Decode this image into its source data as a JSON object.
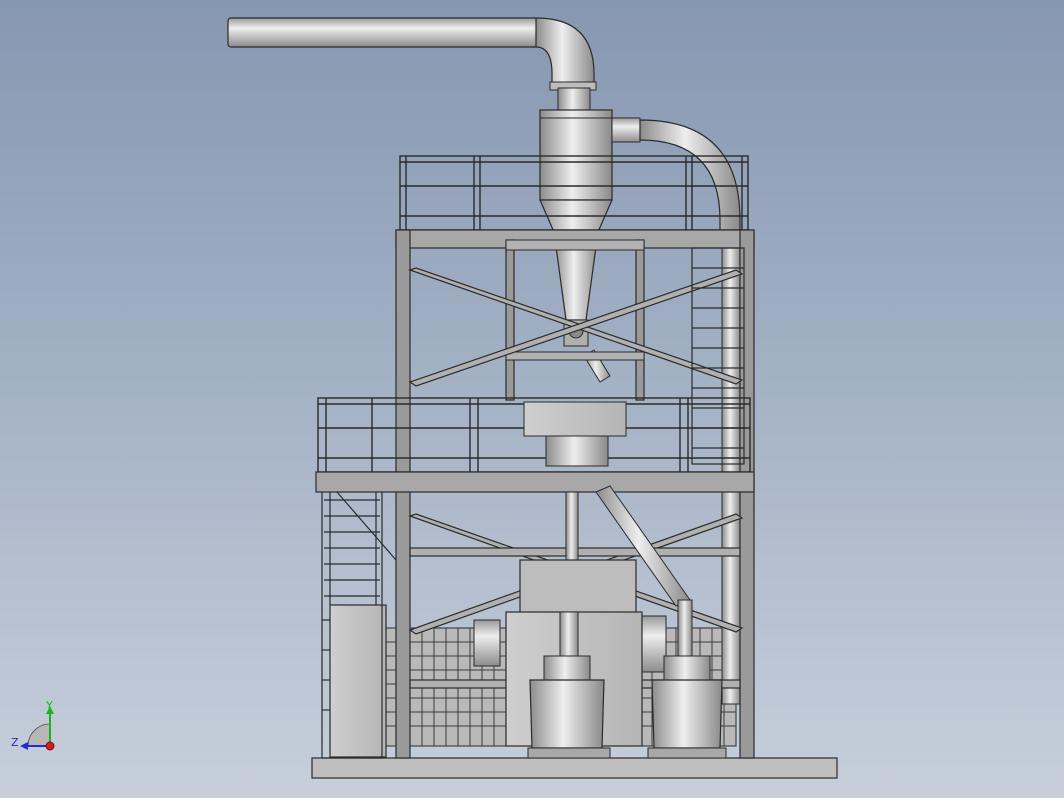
{
  "viewport": {
    "background_top": "#8697b1",
    "background_bottom": "#c7cfdb"
  },
  "model": {
    "frame_color": "#8e8e8e",
    "steel_color": "#c9c9c9",
    "duct_color": "#d2d2d2",
    "outline_color": "#2a2a2a"
  },
  "triad": {
    "x_label": "",
    "y_label": "Y",
    "z_label": "Z",
    "y_axis_color": "#1db31d",
    "z_axis_color": "#2828d8",
    "origin_color": "#d61c1c"
  }
}
